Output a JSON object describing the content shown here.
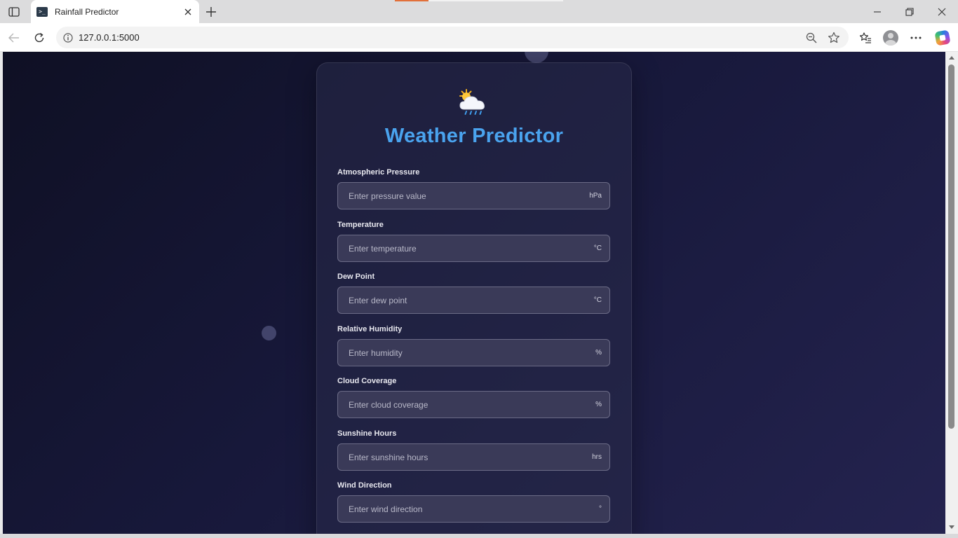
{
  "browser": {
    "tab_title": "Rainfall Predictor",
    "url": "127.0.0.1:5000"
  },
  "page": {
    "title": "Weather Predictor",
    "fields": [
      {
        "label": "Atmospheric Pressure",
        "placeholder": "Enter pressure value",
        "unit": "hPa"
      },
      {
        "label": "Temperature",
        "placeholder": "Enter temperature",
        "unit": "°C"
      },
      {
        "label": "Dew Point",
        "placeholder": "Enter dew point",
        "unit": "°C"
      },
      {
        "label": "Relative Humidity",
        "placeholder": "Enter humidity",
        "unit": "%"
      },
      {
        "label": "Cloud Coverage",
        "placeholder": "Enter cloud coverage",
        "unit": "%"
      },
      {
        "label": "Sunshine Hours",
        "placeholder": "Enter sunshine hours",
        "unit": "hrs"
      },
      {
        "label": "Wind Direction",
        "placeholder": "Enter wind direction",
        "unit": "°"
      }
    ]
  },
  "colors": {
    "title_accent": "#4aa3ee",
    "page_bg_start": "#0f1024",
    "page_bg_end": "#24234f"
  }
}
